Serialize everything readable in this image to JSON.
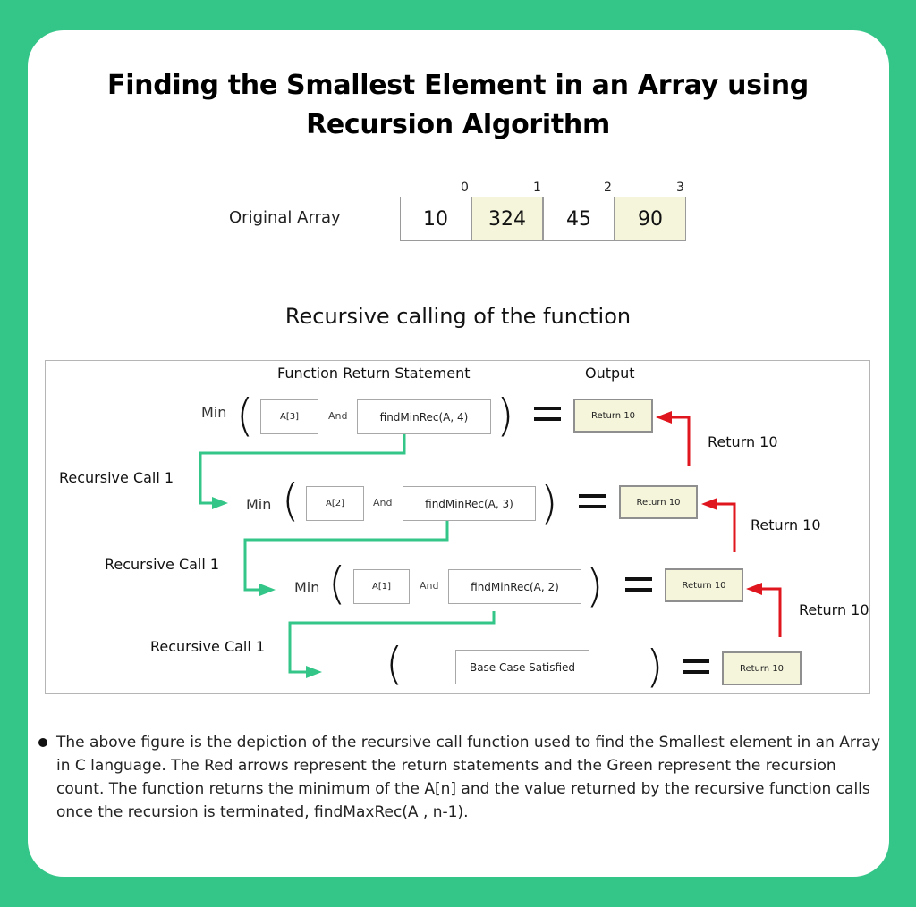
{
  "title": {
    "line1": "Finding the Smallest Element in an Array using",
    "line2": "Recursion Algorithm"
  },
  "array": {
    "label": "Original Array",
    "indices": [
      "0",
      "1",
      "2",
      "3"
    ],
    "values": [
      "10",
      "324",
      "45",
      "90"
    ]
  },
  "section_title": "Recursive calling of the function",
  "diagram": {
    "header_statement": "Function Return Statement",
    "header_output": "Output",
    "rows": [
      {
        "min": "Min",
        "elem": "A[3]",
        "and": "And",
        "call": "findMinRec(A, 4)",
        "output": "Return 10"
      },
      {
        "min": "Min",
        "elem": "A[2]",
        "and": "And",
        "call": "findMinRec(A, 3)",
        "output": "Return 10"
      },
      {
        "min": "Min",
        "elem": "A[1]",
        "and": "And",
        "call": "findMinRec(A, 2)",
        "output": "Return 10"
      },
      {
        "base": "Base Case Satisfied",
        "output": "Return 10"
      }
    ],
    "recursive_labels": [
      "Recursive Call 1",
      "Recursive Call 1",
      "Recursive Call 1"
    ],
    "return_labels": [
      "Return 10",
      "Return 10",
      "Return 10"
    ],
    "colors": {
      "recursion_arrow": "#34c688",
      "return_arrow": "#e0161e",
      "output_fill": "#f5f5dc"
    }
  },
  "description": "The above figure is the depiction of the recursive call function used to find the Smallest element in an Array in C language. The Red arrows represent the return statements and the Green represent the recursion count. The function returns the minimum of the A[n] and the value returned by the recursive function calls once the recursion is terminated, findMaxRec(A , n-1).",
  "colors": {
    "background": "#34c688",
    "card": "#ffffff",
    "alt_cell": "#f5f5dc"
  }
}
